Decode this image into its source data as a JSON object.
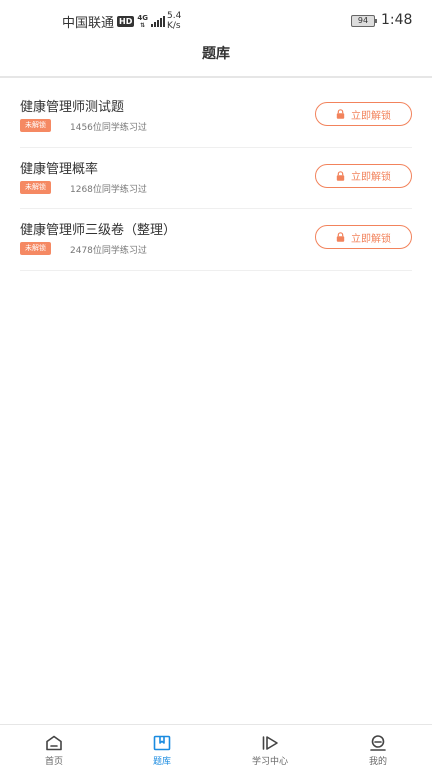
{
  "status_bar": {
    "carrier": "中国联通",
    "hd": "HD",
    "network": "4G",
    "speed_value": "5.4",
    "speed_unit": "K/s",
    "battery": "94",
    "time": "1:48"
  },
  "header": {
    "title": "题库"
  },
  "question_banks": [
    {
      "title": "健康管理师测试题",
      "tag": "未解锁",
      "learners": "1456位同学练习过",
      "unlock_label": "立即解锁"
    },
    {
      "title": "健康管理概率",
      "tag": "未解锁",
      "learners": "1268位同学练习过",
      "unlock_label": "立即解锁"
    },
    {
      "title": "健康管理师三级卷（整理）",
      "tag": "未解锁",
      "learners": "2478位同学练习过",
      "unlock_label": "立即解锁"
    }
  ],
  "tabbar": {
    "tabs": [
      {
        "label": "首页",
        "icon": "home-icon",
        "active": false
      },
      {
        "label": "题库",
        "icon": "question-bank-icon",
        "active": true
      },
      {
        "label": "学习中心",
        "icon": "play-icon",
        "active": false
      },
      {
        "label": "我的",
        "icon": "profile-icon",
        "active": false
      }
    ]
  },
  "colors": {
    "accent": "#f2835c",
    "tag_bg": "#f58963",
    "active_tab": "#1a8be0",
    "text": "#333333",
    "muted": "#777777"
  }
}
